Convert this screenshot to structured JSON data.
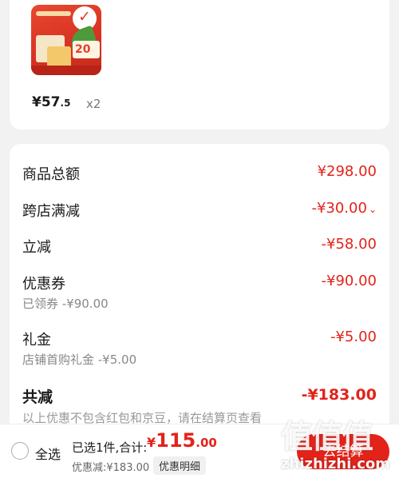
{
  "product": {
    "image_icon": "product-image",
    "coupon_number": "20",
    "price_symbol": "¥",
    "price_int": "57",
    "price_dec": ".5",
    "quantity": "x2"
  },
  "summary": {
    "rows": [
      {
        "label": "商品总额",
        "value": "¥298.00"
      },
      {
        "label": "跨店满减",
        "value": "-¥30.00"
      },
      {
        "label": "立减",
        "value": "-¥58.00"
      },
      {
        "label": "优惠券",
        "value": "-¥90.00",
        "sub": "已领券 -¥90.00"
      },
      {
        "label": "礼金",
        "value": "-¥5.00",
        "sub": "店铺首购礼金 -¥5.00"
      }
    ],
    "total_label": "共减",
    "total_value": "-¥183.00",
    "note": "以上优惠不包含红包和京豆，请在结算页查看"
  },
  "bottom_bar": {
    "select_all": "全选",
    "selected_total_text": "已选1件,合计:",
    "price_symbol": "¥",
    "price_int": "115",
    "price_dec": ".00",
    "discount_text": "优惠减:¥183.00",
    "detail_button": "优惠明细",
    "checkout_button": "去结算"
  },
  "watermark": {
    "glyphs": "值值值",
    "url": "zhizhizhi.com"
  },
  "colors": {
    "accent": "#e2231a",
    "background": "#f2f2f2"
  }
}
